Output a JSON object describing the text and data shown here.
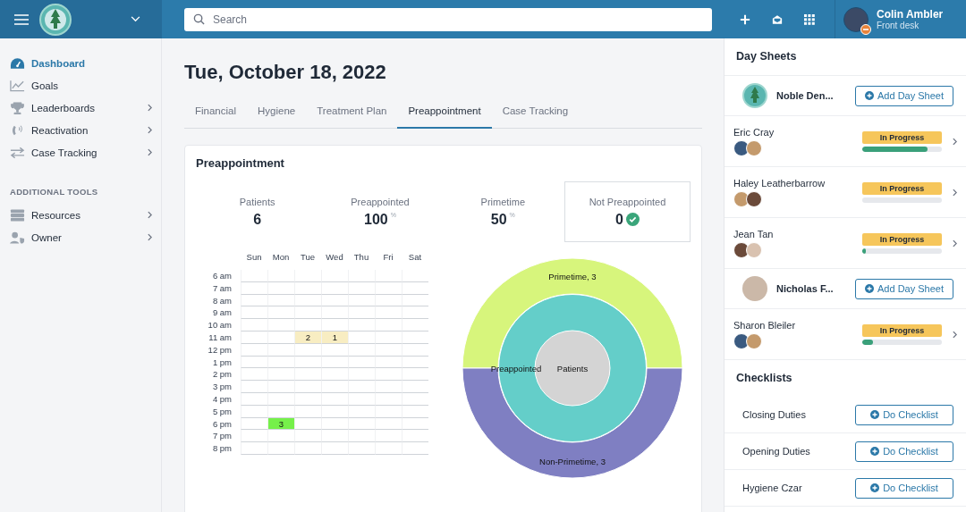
{
  "topbar": {
    "search": {
      "placeholder": "Search"
    },
    "user": {
      "name": "Colin Ambler",
      "role": "Front desk",
      "busy": true
    }
  },
  "nav": [
    {
      "label": "Dashboard",
      "selected": true,
      "submenu": false
    },
    {
      "label": "Goals",
      "selected": false,
      "submenu": false
    },
    {
      "label": "Leaderboards",
      "selected": false,
      "submenu": true
    },
    {
      "label": "Reactivation",
      "selected": false,
      "submenu": true
    },
    {
      "label": "Case Tracking",
      "selected": false,
      "submenu": true
    }
  ],
  "tools_heading": "ADDITIONAL TOOLS",
  "tools": [
    {
      "label": "Resources",
      "selected": false,
      "submenu": true
    },
    {
      "label": "Owner",
      "selected": false,
      "submenu": true
    }
  ],
  "page": {
    "title": "Tue, October 18, 2022",
    "tabs": [
      {
        "label": "Financial",
        "selected": false
      },
      {
        "label": "Hygiene",
        "selected": false
      },
      {
        "label": "Treatment Plan",
        "selected": false
      },
      {
        "label": "Preappointment",
        "selected": true
      },
      {
        "label": "Case Tracking",
        "selected": false
      }
    ],
    "card": {
      "title": "Preappointment",
      "stats": [
        {
          "label": "Patients",
          "value": "6",
          "highlighted": false,
          "check": false
        },
        {
          "label": "Preappointed",
          "value": "100",
          "unit": "%",
          "highlighted": false,
          "check": false
        },
        {
          "label": "Primetime",
          "value": "50",
          "unit": "%",
          "highlighted": false,
          "check": false
        },
        {
          "label": "Not Preappointed",
          "value": "0",
          "highlighted": true,
          "check": true
        }
      ],
      "heatmap": {
        "days": [
          "Sun",
          "Mon",
          "Tue",
          "Wed",
          "Thu",
          "Fri",
          "Sat"
        ],
        "rows": [
          {
            "hour": "6 am",
            "cells": [
              {
                "filled": false
              },
              {
                "filled": false
              },
              {
                "filled": false
              },
              {
                "filled": false
              },
              {
                "filled": false
              },
              {
                "filled": false
              },
              {
                "filled": false
              }
            ]
          },
          {
            "hour": "7 am",
            "cells": [
              {
                "filled": false
              },
              {
                "filled": false
              },
              {
                "filled": false
              },
              {
                "filled": false
              },
              {
                "filled": false
              },
              {
                "filled": false
              },
              {
                "filled": false
              }
            ]
          },
          {
            "hour": "8 am",
            "cells": [
              {
                "filled": false
              },
              {
                "filled": false
              },
              {
                "filled": false
              },
              {
                "filled": false
              },
              {
                "filled": false
              },
              {
                "filled": false
              },
              {
                "filled": false
              }
            ]
          },
          {
            "hour": "9 am",
            "cells": [
              {
                "filled": false
              },
              {
                "filled": false
              },
              {
                "filled": false
              },
              {
                "filled": false
              },
              {
                "filled": false
              },
              {
                "filled": false
              },
              {
                "filled": false
              }
            ]
          },
          {
            "hour": "10 am",
            "cells": [
              {
                "filled": false
              },
              {
                "filled": false
              },
              {
                "filled": false
              },
              {
                "filled": false
              },
              {
                "filled": false
              },
              {
                "filled": false
              },
              {
                "filled": false
              }
            ]
          },
          {
            "hour": "11 am",
            "cells": [
              {
                "filled": false
              },
              {
                "filled": false
              },
              {
                "filled": true,
                "value": "2",
                "color": "#f8edc2"
              },
              {
                "filled": true,
                "value": "1",
                "color": "#f8edc2"
              },
              {
                "filled": false
              },
              {
                "filled": false
              },
              {
                "filled": false
              }
            ]
          },
          {
            "hour": "12 pm",
            "cells": [
              {
                "filled": false
              },
              {
                "filled": false
              },
              {
                "filled": false
              },
              {
                "filled": false
              },
              {
                "filled": false
              },
              {
                "filled": false
              },
              {
                "filled": false
              }
            ]
          },
          {
            "hour": "1 pm",
            "cells": [
              {
                "filled": false
              },
              {
                "filled": false
              },
              {
                "filled": false
              },
              {
                "filled": false
              },
              {
                "filled": false
              },
              {
                "filled": false
              },
              {
                "filled": false
              }
            ]
          },
          {
            "hour": "2 pm",
            "cells": [
              {
                "filled": false
              },
              {
                "filled": false
              },
              {
                "filled": false
              },
              {
                "filled": false
              },
              {
                "filled": false
              },
              {
                "filled": false
              },
              {
                "filled": false
              }
            ]
          },
          {
            "hour": "3 pm",
            "cells": [
              {
                "filled": false
              },
              {
                "filled": false
              },
              {
                "filled": false
              },
              {
                "filled": false
              },
              {
                "filled": false
              },
              {
                "filled": false
              },
              {
                "filled": false
              }
            ]
          },
          {
            "hour": "4 pm",
            "cells": [
              {
                "filled": false
              },
              {
                "filled": false
              },
              {
                "filled": false
              },
              {
                "filled": false
              },
              {
                "filled": false
              },
              {
                "filled": false
              },
              {
                "filled": false
              }
            ]
          },
          {
            "hour": "5 pm",
            "cells": [
              {
                "filled": false
              },
              {
                "filled": false
              },
              {
                "filled": false
              },
              {
                "filled": false
              },
              {
                "filled": false
              },
              {
                "filled": false
              },
              {
                "filled": false
              }
            ]
          },
          {
            "hour": "6 pm",
            "cells": [
              {
                "filled": false
              },
              {
                "filled": true,
                "value": "3",
                "color": "#76f04a"
              },
              {
                "filled": false
              },
              {
                "filled": false
              },
              {
                "filled": false
              },
              {
                "filled": false
              },
              {
                "filled": false
              }
            ]
          },
          {
            "hour": "7 pm",
            "cells": [
              {
                "filled": false
              },
              {
                "filled": false
              },
              {
                "filled": false
              },
              {
                "filled": false
              },
              {
                "filled": false
              },
              {
                "filled": false
              },
              {
                "filled": false
              }
            ]
          },
          {
            "hour": "8 pm",
            "cells": [
              {
                "filled": false
              },
              {
                "filled": false
              },
              {
                "filled": false
              },
              {
                "filled": false
              },
              {
                "filled": false
              },
              {
                "filled": false
              },
              {
                "filled": false
              }
            ]
          }
        ]
      },
      "sunburst": {
        "outer": [
          {
            "label": "Primetime, 3",
            "color": "#d7f57c"
          },
          {
            "label": "Non-Primetime, 3",
            "color": "#7f7fc2"
          }
        ],
        "middle": {
          "label": "Preappointed",
          "color": "#64cec9"
        },
        "center": {
          "label": "Patients",
          "color": "#d4d4d4"
        }
      }
    }
  },
  "day_sheets": {
    "title": "Day Sheets",
    "items": [
      {
        "kind": "add",
        "name": "Noble Den...",
        "button": "Add Day Sheet"
      },
      {
        "kind": "progress",
        "name": "Eric Cray",
        "status": "In Progress",
        "level": 0.82
      },
      {
        "kind": "progress",
        "name": "Haley Leatherbarrow",
        "status": "In Progress",
        "level": 0
      },
      {
        "kind": "progress",
        "name": "Jean Tan",
        "status": "In Progress",
        "level": 0.05
      },
      {
        "kind": "add",
        "name": "Nicholas F...",
        "button": "Add Day Sheet"
      },
      {
        "kind": "progress",
        "name": "Sharon Bleiler",
        "status": "In Progress",
        "level": 0.14
      }
    ]
  },
  "checklists": {
    "title": "Checklists",
    "items": [
      {
        "name": "Closing Duties",
        "button": "Do Checklist"
      },
      {
        "name": "Opening Duties",
        "button": "Do Checklist"
      },
      {
        "name": "Hygiene Czar",
        "button": "Do Checklist"
      }
    ]
  }
}
